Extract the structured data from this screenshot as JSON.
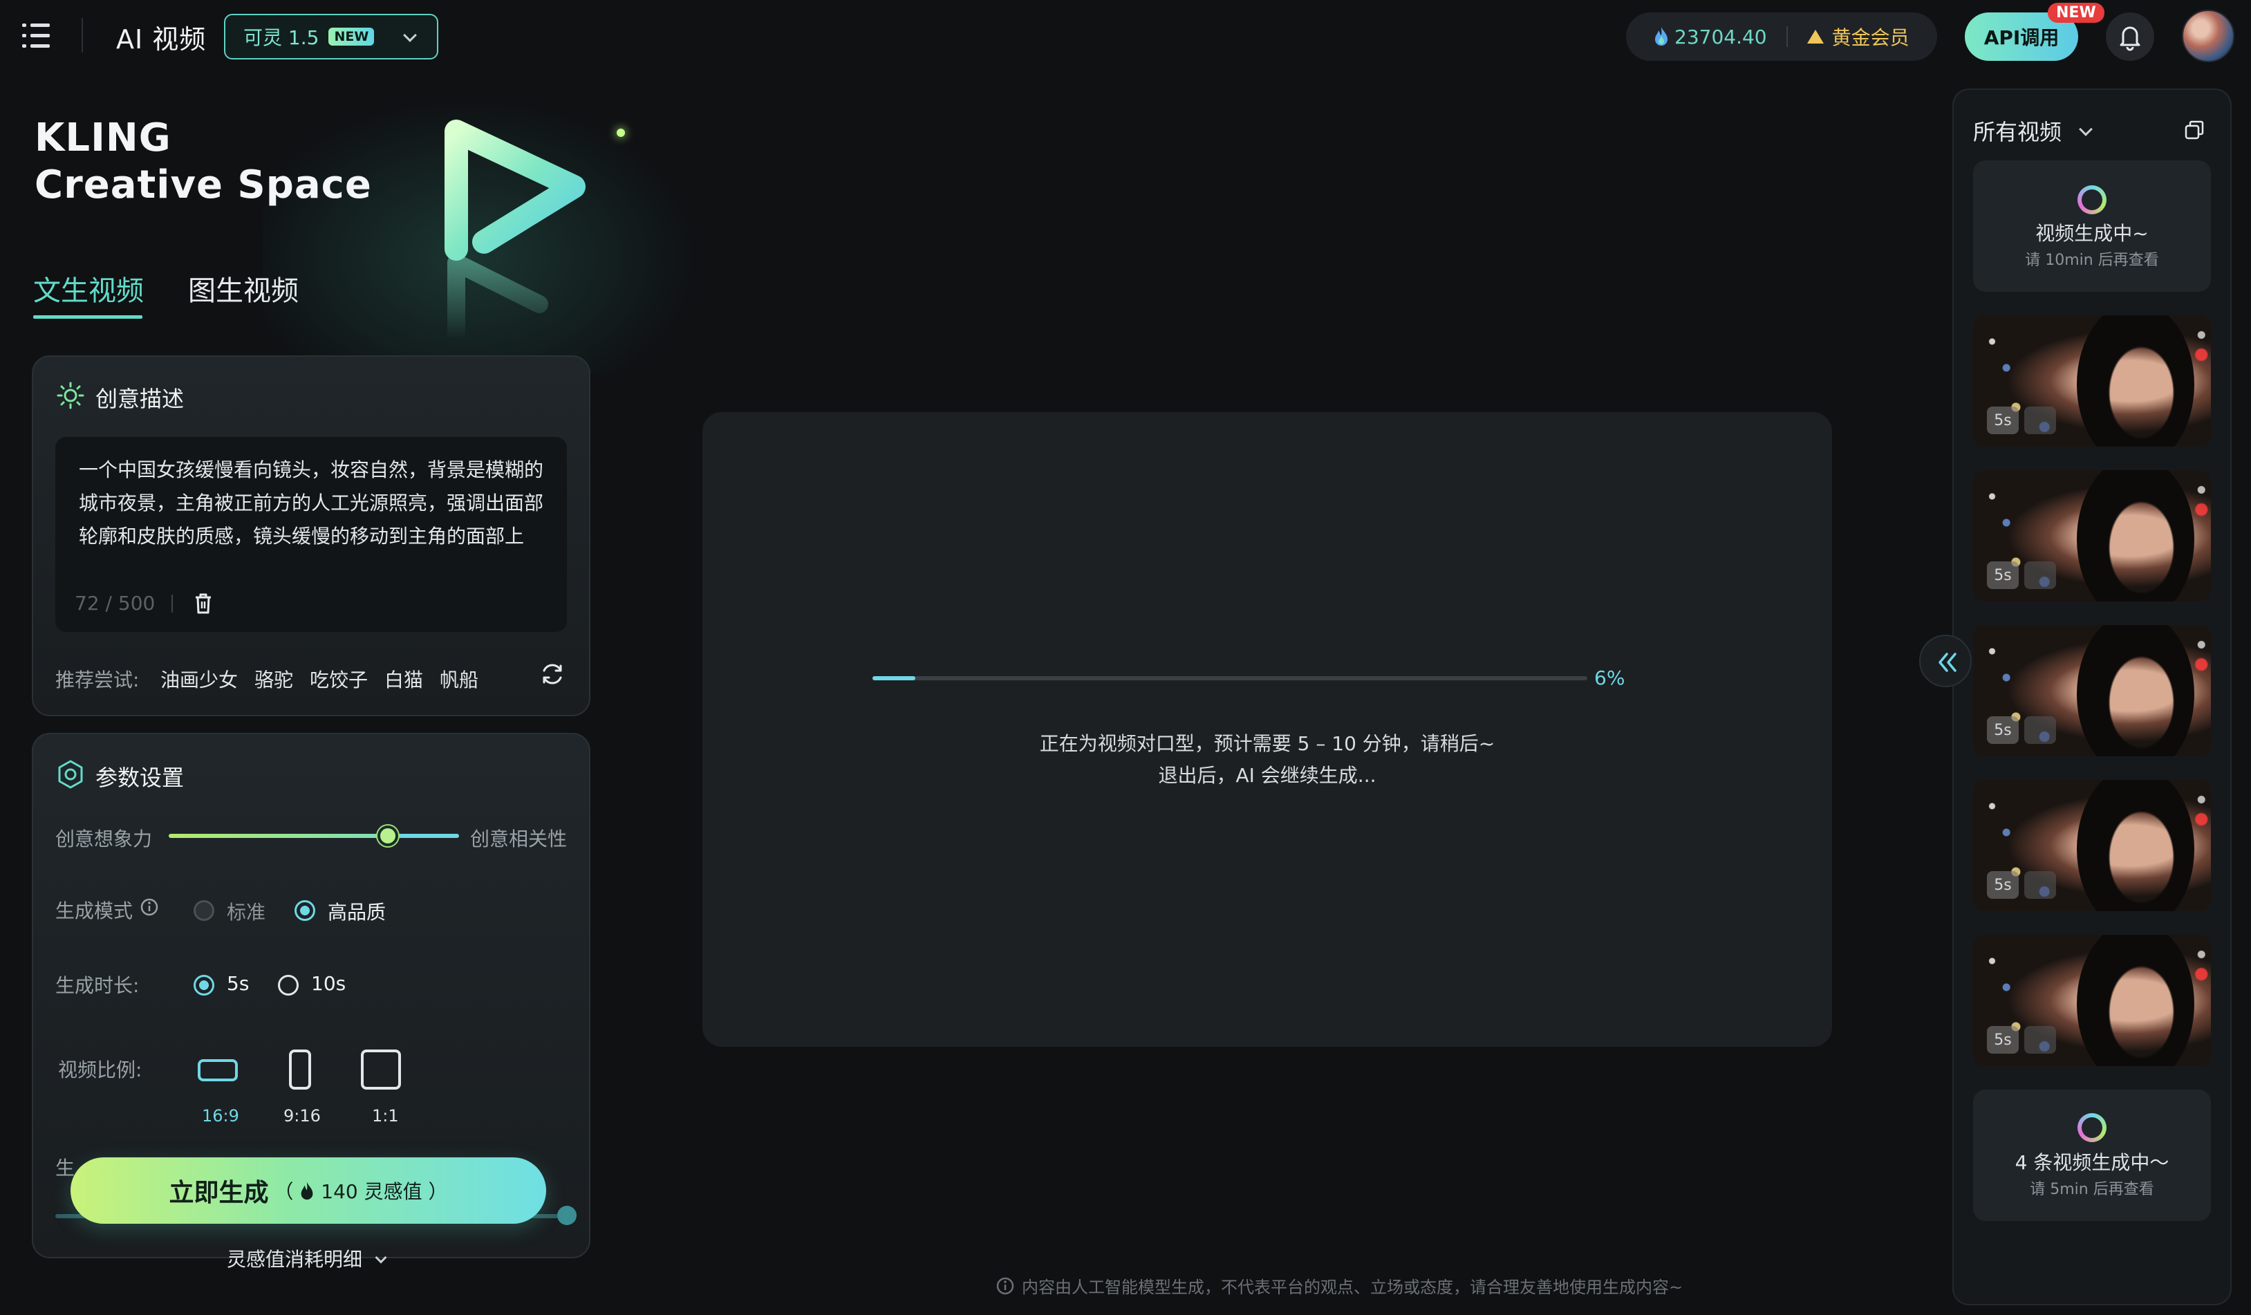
{
  "header": {
    "app_title": "AI 视频",
    "model_label": "可灵 1.5",
    "model_badge": "NEW",
    "credits": "23704.40",
    "membership": "黄金会员",
    "api_label": "API调用",
    "api_badge": "NEW"
  },
  "hero": {
    "brand_line1": "KLING",
    "brand_line2": "Creative Space"
  },
  "tabs": [
    {
      "label": "文生视频",
      "active": true
    },
    {
      "label": "图生视频",
      "active": false
    }
  ],
  "description": {
    "title": "创意描述",
    "prompt": "一个中国女孩缓慢看向镜头，妆容自然，背景是模糊的城市夜景，主角被正前方的人工光源照亮，强调出面部轮廓和皮肤的质感，镜头缓慢的移动到主角的面部上",
    "count": "72",
    "max": "500",
    "suggest_label": "推荐尝试:",
    "suggestions": [
      "油画少女",
      "骆驼",
      "吃饺子",
      "白猫",
      "帆船"
    ]
  },
  "params": {
    "title": "参数设置",
    "slider_left": "创意想象力",
    "slider_right": "创意相关性",
    "slider_value": 0.74,
    "mode_label": "生成模式",
    "mode_options": [
      "标准",
      "高品质"
    ],
    "mode_selected": "高品质",
    "duration_label": "生成时长:",
    "duration_options": [
      "5s",
      "10s"
    ],
    "duration_selected": "5s",
    "ratio_label": "视频比例:",
    "ratios": [
      "16:9",
      "9:16",
      "1:1"
    ],
    "ratio_selected": "16:9",
    "hidden_label_fragment": "生"
  },
  "generate": {
    "label": "立即生成",
    "cost_open": "（",
    "cost": "140 灵感值",
    "cost_close": "）",
    "detail_link": "灵感值消耗明细"
  },
  "progress": {
    "percent_value": 6,
    "percent_text": "6%",
    "line1": "正在为视频对口型，预计需要 5 – 10 分钟，请稍后~",
    "line2": "退出后，AI 会继续生成..."
  },
  "footer": {
    "note": "内容由人工智能模型生成，不代表平台的观点、立场或态度，请合理友善地使用生成内容~"
  },
  "sidebar": {
    "filter_label": "所有视频",
    "top_card": {
      "title": "视频生成中~",
      "sub": "请 10min 后再查看"
    },
    "videos": [
      {
        "duration": "5s"
      },
      {
        "duration": "5s"
      },
      {
        "duration": "5s"
      },
      {
        "duration": "5s"
      },
      {
        "duration": "5s"
      }
    ],
    "bottom_card": {
      "title": "4 条视频生成中～",
      "sub": "请 5min 后再查看"
    }
  },
  "colors": {
    "accent": "#62dcc9",
    "progress": "#6fd8e6",
    "gold": "#f0c65a",
    "background": "#0f1113"
  },
  "icons": [
    "menu-icon",
    "chevron-down-icon",
    "flame-icon",
    "crown-icon",
    "bell-icon",
    "sun-icon",
    "trash-icon",
    "refresh-icon",
    "gear-hex-icon",
    "info-icon",
    "copy-icon",
    "double-chevron-left-icon",
    "lip-sync-icon",
    "spinner-icon"
  ]
}
